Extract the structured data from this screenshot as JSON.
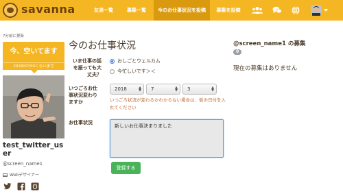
{
  "header": {
    "brand": "savanna",
    "nav": [
      {
        "label": "友達一覧"
      },
      {
        "label": "募集一覧"
      },
      {
        "label": "今のお仕事状況を投稿"
      },
      {
        "label": "募集を投稿"
      }
    ],
    "icons": [
      "group-icon",
      "chat-icon",
      "globe-icon",
      "avatar-dropdown"
    ]
  },
  "sidebar": {
    "updated": "7分前に更新",
    "status": "今、空いてます",
    "status_date": "2018/07/03くらいまで",
    "username": "test_twitter_user",
    "screen_name": "@screen_name1",
    "job": "Webデザイナー",
    "social": [
      "twitter-icon",
      "facebook-icon",
      "github-icon"
    ]
  },
  "main": {
    "title": "今のお仕事状況",
    "q1_label": "いま仕事の話を振っても大丈夫？",
    "options": [
      {
        "label": "おしごとウェルカム",
        "checked": true
      },
      {
        "label": "今忙しいです＞＜",
        "checked": false
      }
    ],
    "q2_label": "いつごろお仕事状況変わりますか",
    "year": "2018",
    "month": "7",
    "day": "3",
    "hint": "いつごろ状況が変わるかわからない場合は、仮の日付を入れてください",
    "q3_label": "お仕事状況",
    "status_text": "新しいお仕事決まりました",
    "submit": "登録する"
  },
  "right": {
    "title_name": "@screen_name1",
    "title_suffix": " の募集",
    "count": "0",
    "empty": "現在の募集はありません"
  },
  "colors": {
    "brand": "#f5b624",
    "nav_active": "#d99a0f",
    "button": "#49b35a",
    "hint": "#c2662d"
  }
}
